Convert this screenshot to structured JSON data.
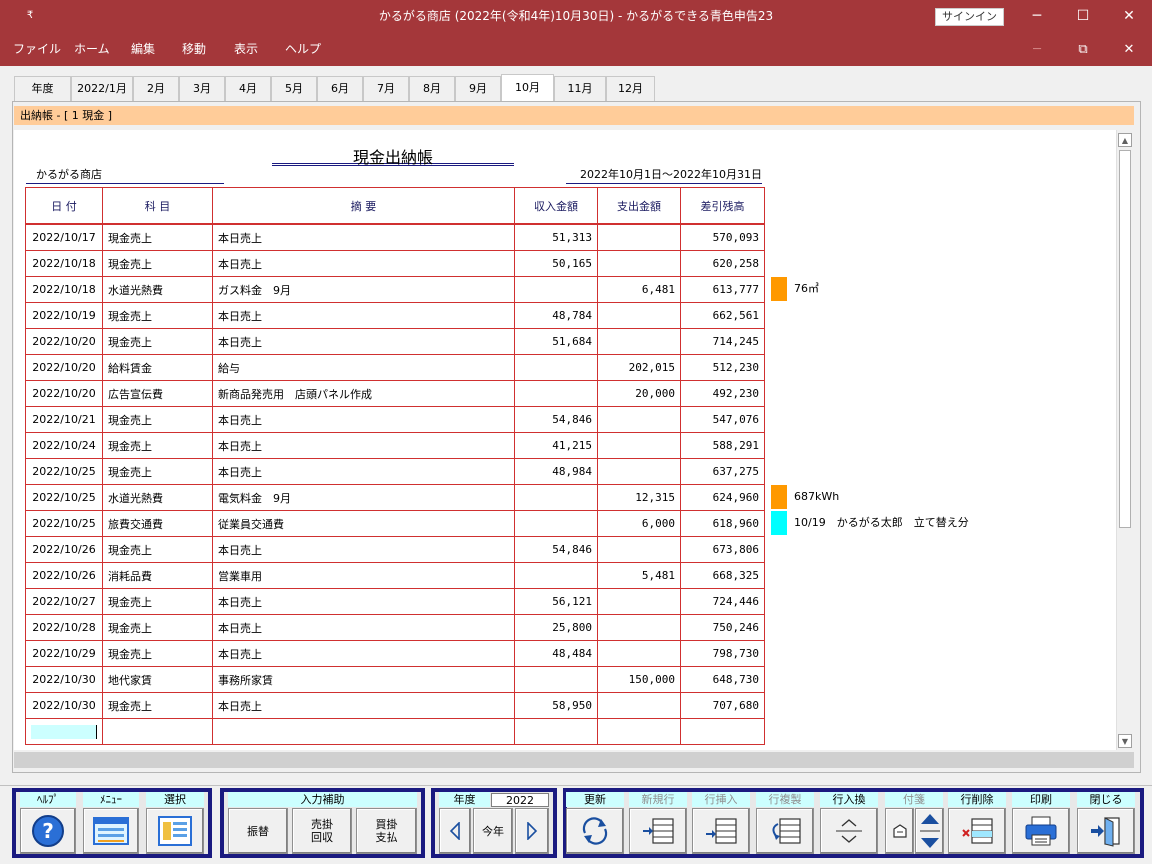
{
  "window": {
    "title": "かるがる商店 (2022年(令和4年)10月30日)  -  かるがるできる青色申告23",
    "signin": "サインイン",
    "minimize": "─",
    "maximize": "☐",
    "close": "✕",
    "sysmenu": "₹"
  },
  "menu": [
    "ファイル",
    "ホーム",
    "編集",
    "移動",
    "表示",
    "ヘルプ"
  ],
  "mdi": {
    "minimize": "─",
    "restore": "⧉",
    "close": "✕"
  },
  "tabs": [
    "年度",
    "2022/1月",
    "2月",
    "3月",
    "4月",
    "5月",
    "6月",
    "7月",
    "8月",
    "9月",
    "10月",
    "11月",
    "12月"
  ],
  "active_tab": "10月",
  "banner": "出納帳 - [ 1 現金 ]",
  "ledger": {
    "title": "現金出納帳",
    "store": "かるがる商店",
    "period": "2022年10月1日～2022年10月31日",
    "headers": [
      "日 付",
      "科  目",
      "摘      要",
      "収入金額",
      "支出金額",
      "差引残高"
    ],
    "rows": [
      [
        "2022/10/17",
        "現金売上",
        "本日売上",
        "51,313",
        "",
        "570,093"
      ],
      [
        "2022/10/18",
        "現金売上",
        "本日売上",
        "50,165",
        "",
        "620,258"
      ],
      [
        "2022/10/18",
        "水道光熱費",
        "ガス料金　9月",
        "",
        "6,481",
        "613,777"
      ],
      [
        "2022/10/19",
        "現金売上",
        "本日売上",
        "48,784",
        "",
        "662,561"
      ],
      [
        "2022/10/20",
        "現金売上",
        "本日売上",
        "51,684",
        "",
        "714,245"
      ],
      [
        "2022/10/20",
        "給料賃金",
        "給与",
        "",
        "202,015",
        "512,230"
      ],
      [
        "2022/10/20",
        "広告宣伝費",
        "新商品発売用　店頭パネル作成",
        "",
        "20,000",
        "492,230"
      ],
      [
        "2022/10/21",
        "現金売上",
        "本日売上",
        "54,846",
        "",
        "547,076"
      ],
      [
        "2022/10/24",
        "現金売上",
        "本日売上",
        "41,215",
        "",
        "588,291"
      ],
      [
        "2022/10/25",
        "現金売上",
        "本日売上",
        "48,984",
        "",
        "637,275"
      ],
      [
        "2022/10/25",
        "水道光熱費",
        "電気料金　9月",
        "",
        "12,315",
        "624,960"
      ],
      [
        "2022/10/25",
        "旅費交通費",
        "従業員交通費",
        "",
        "6,000",
        "618,960"
      ],
      [
        "2022/10/26",
        "現金売上",
        "本日売上",
        "54,846",
        "",
        "673,806"
      ],
      [
        "2022/10/26",
        "消耗品費",
        "営業車用",
        "",
        "5,481",
        "668,325"
      ],
      [
        "2022/10/27",
        "現金売上",
        "本日売上",
        "56,121",
        "",
        "724,446"
      ],
      [
        "2022/10/28",
        "現金売上",
        "本日売上",
        "25,800",
        "",
        "750,246"
      ],
      [
        "2022/10/29",
        "現金売上",
        "本日売上",
        "48,484",
        "",
        "798,730"
      ],
      [
        "2022/10/30",
        "地代家賃",
        "事務所家賃",
        "",
        "150,000",
        "648,730"
      ],
      [
        "2022/10/30",
        "現金売上",
        "本日売上",
        "58,950",
        "",
        "707,680"
      ]
    ]
  },
  "notes": [
    {
      "text": "76㎥",
      "color": "#ff9900"
    },
    {
      "text": "687kWh",
      "color": "#ff9900"
    },
    {
      "text": "10/19　かるがる太郎　立て替え分",
      "color": "#00ffff"
    }
  ],
  "toolbar": {
    "help": "ﾍﾙﾌﾟ",
    "menu": "ﾒﾆｭｰ",
    "select": "選択",
    "input_assist": "入力補助",
    "transfer": "振替",
    "ar_collect": "売掛\n回収",
    "ap_pay": "買掛\n支払",
    "year_label": "年度",
    "year_value": "2022",
    "this_year": "今年",
    "refresh": "更新",
    "new_row": "新規行",
    "insert_row": "行挿入",
    "copy_row": "行複製",
    "swap_row": "行入換",
    "sticky": "付箋",
    "delete_row": "行削除",
    "print": "印刷",
    "close": "閉じる"
  }
}
